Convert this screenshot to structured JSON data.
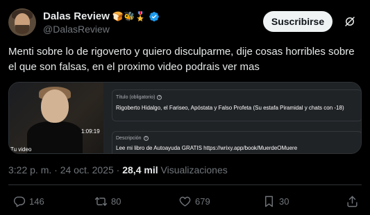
{
  "author": {
    "display_name": "Dalas Review",
    "emojis": "🍞🐝🎖️",
    "handle": "@DalasReview"
  },
  "header": {
    "subscribe_label": "Suscribirse"
  },
  "tweet": {
    "text": "Menti sobre lo de rigoverto y quiero disculparme, dije cosas horribles sobre el que son falsas, en el proximo video podrais ver mas"
  },
  "media": {
    "duration": "1:09:19",
    "thumb_label": "Tu video",
    "title_label": "Título (obligatorio)",
    "title_value": "Rigoberto Hidalgo, el Fariseo, Apóstata y Falso Profeta (Su estafa Piramidal y chats con -18)",
    "description_label": "Descripción",
    "description_value": "Lee mi libro de Autoayuda GRATIS https://wrixy.app/book/MuerdeOMuere",
    "help_glyph": "?"
  },
  "meta": {
    "time": "3:22 p. m.",
    "separator": " · ",
    "date": "24 oct. 2025",
    "dot": " · ",
    "views_count": "28,4 mil",
    "views_label": " Visualizaciones"
  },
  "actions": {
    "replies": "146",
    "reposts": "80",
    "likes": "679",
    "bookmarks": "30"
  },
  "colors": {
    "background": "#000000",
    "text": "#e7e9ea",
    "muted": "#71767b",
    "verified": "#1d9bf0",
    "button_bg": "#eff3f4"
  },
  "icons": [
    "verified-badge-icon",
    "grok-icon",
    "reply-icon",
    "repost-icon",
    "like-icon",
    "bookmark-icon",
    "share-icon",
    "help-icon"
  ]
}
